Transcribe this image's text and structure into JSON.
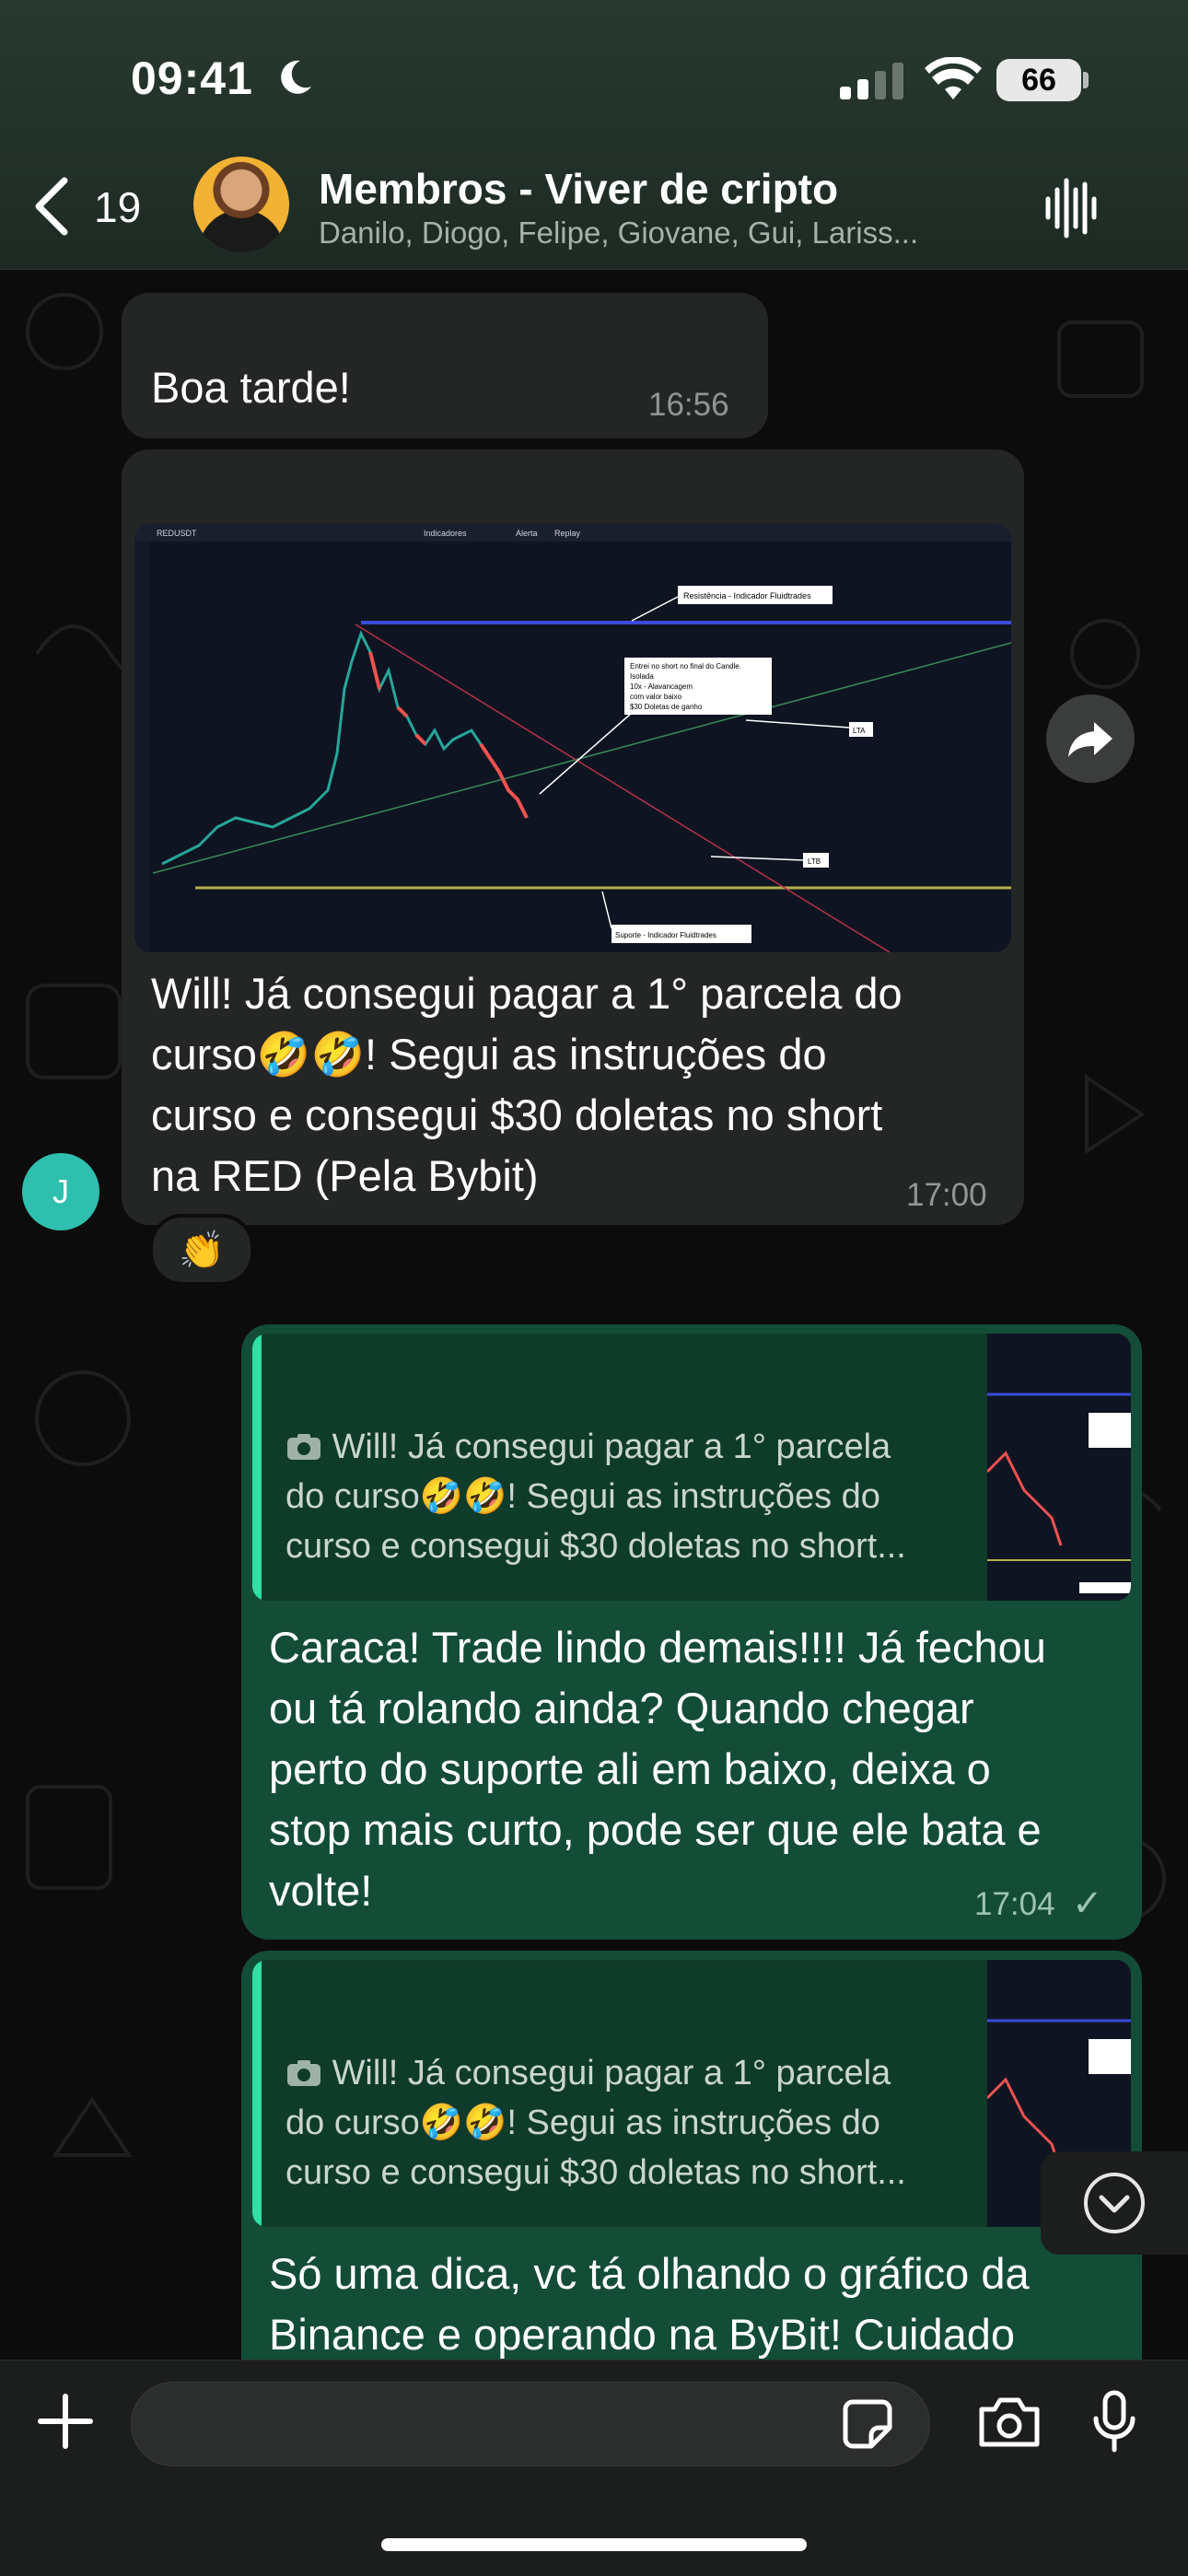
{
  "status_bar": {
    "time": "09:41",
    "battery": "66"
  },
  "header": {
    "back_count": "19",
    "title": "Membros - Viver de cripto",
    "members": "Danilo, Diogo, Felipe, Giovane, Gui, Lariss..."
  },
  "messages": {
    "m1": {
      "text": "Boa tarde!",
      "time": "16:56"
    },
    "m2": {
      "line1": "Will! Já consegui pagar a 1° parcela do",
      "line2": "curso🤣🤣! Segui as instruções do",
      "line3": "curso e consegui $30 doletas no short",
      "line4": "na RED (Pela Bybit)",
      "time": "17:00",
      "sender_initial": "J",
      "reaction": "👏",
      "chart_labels": {
        "resistance": "Resistência - Indicador Fluidtrades",
        "entry_l1": "Entrei no short no final do Candle.",
        "entry_l2": "Isolada",
        "entry_l3": "10x - Alavancagem",
        "entry_l4": "com valor baixo",
        "entry_l5": "$30 Doletas de ganho",
        "lta": "LTA",
        "ltb": "LTB",
        "support": "Suporte - Indicador Fluidtrades",
        "toolbar_pair": "REDUSDT",
        "toolbar_indicators": "Indicadores",
        "toolbar_alert": "Alerta",
        "toolbar_replay": "Replay"
      }
    },
    "m3": {
      "quote_l1": "Will! Já consegui pagar a 1° parcela",
      "quote_l2": "do curso🤣🤣! Segui as instruções do",
      "quote_l3": "curso e consegui $30 doletas no short...",
      "line1": "Caraca! Trade lindo demais!!!! Já fechou",
      "line2": "ou tá rolando ainda? Quando chegar",
      "line3": "perto do suporte ali em baixo, deixa o",
      "line4": "stop mais curto, pode ser que ele bata e",
      "line5": "volte!",
      "time": "17:04",
      "check": "✓"
    },
    "m4": {
      "quote_l1": "Will! Já consegui pagar a 1° parcela",
      "quote_l2": "do curso🤣🤣! Segui as instruções do",
      "quote_l3": "curso e consegui $30 doletas no short...",
      "line1": "Só uma dica, vc tá olhando o gráfico da",
      "line2": "Binance e operando na ByBit! Cuidado"
    }
  },
  "icons": [
    "moon-icon",
    "signal-icon",
    "wifi-icon",
    "back-chevron-icon",
    "voice-waveform-icon",
    "share-icon",
    "camera-icon",
    "chevron-down-icon",
    "plus-icon",
    "sticker-icon",
    "microphone-icon"
  ],
  "colors": {
    "outgoing_bubble": "#144d37",
    "incoming_bubble": "#242626",
    "quote_bar": "#2ee0a3",
    "header": "#1d2a23"
  }
}
